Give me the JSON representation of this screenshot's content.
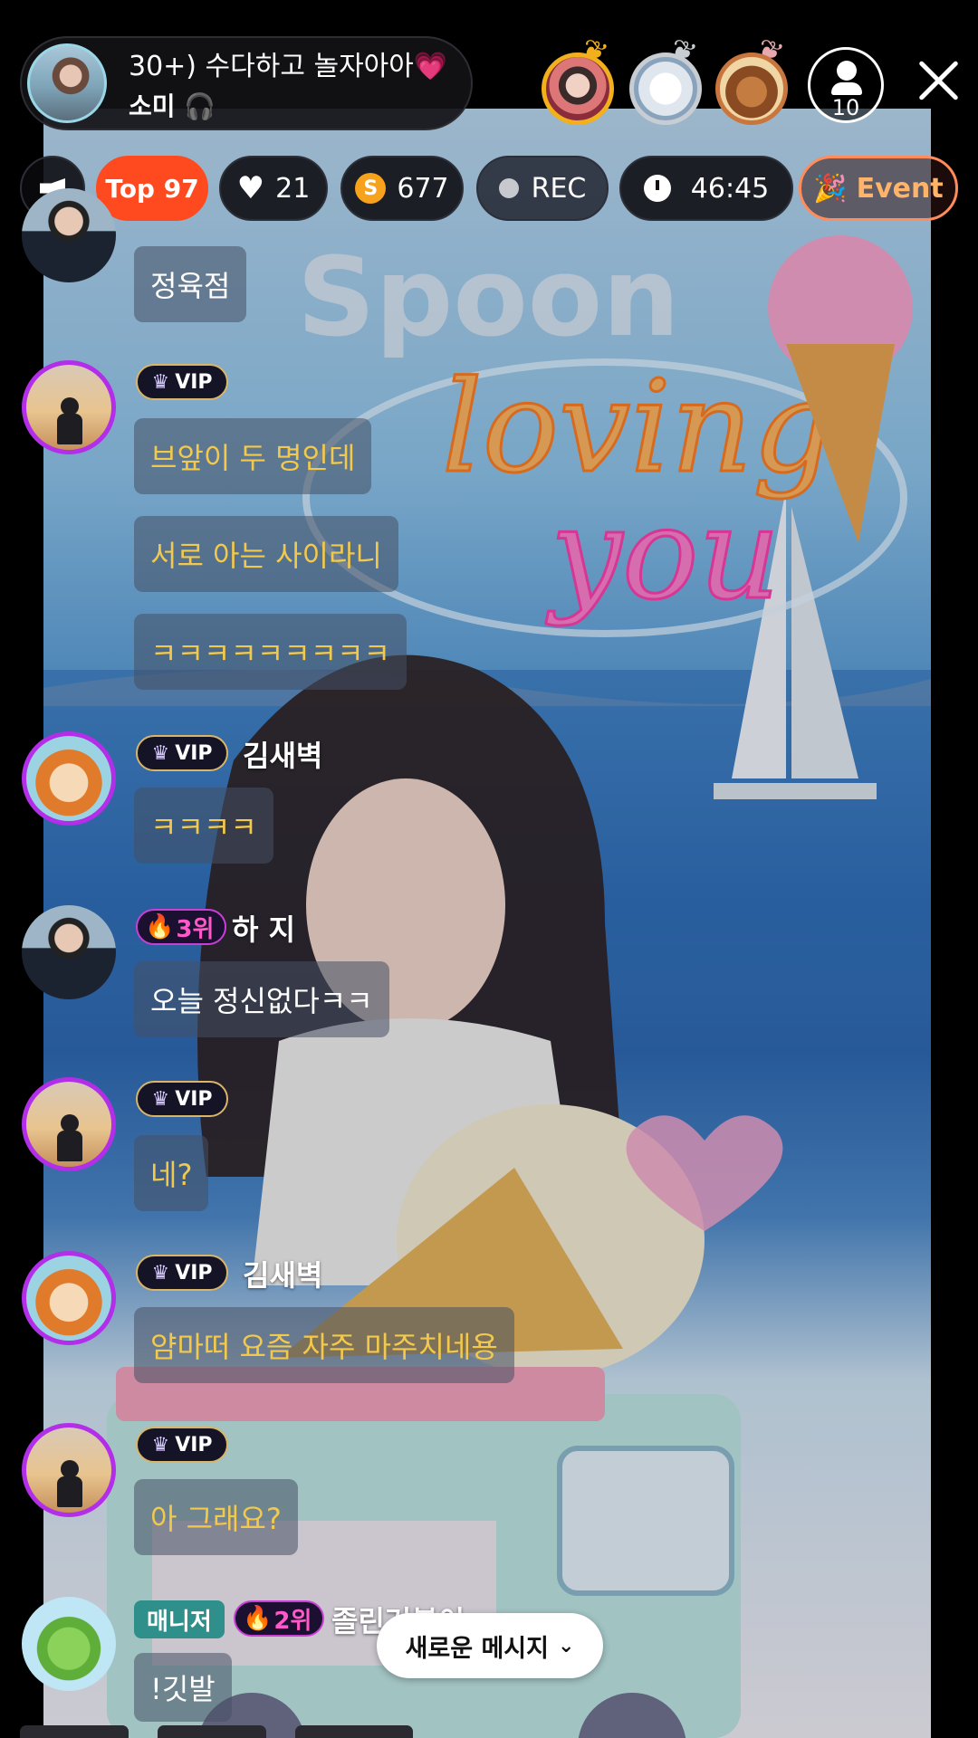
{
  "header": {
    "title": "30+) 수다하고 놀자아아",
    "title_emoji": "💗",
    "host_name": "소미",
    "host_icon": "🎧",
    "listener_count": "10"
  },
  "stats": {
    "top_label": "Top 97",
    "likes": "21",
    "spoons": "677",
    "coin_letter": "S",
    "rec_label": "REC",
    "timer": "46:45",
    "event_label": "Event"
  },
  "chat": {
    "vip_label": "VIP",
    "manager_label": "매니저",
    "messages": [
      {
        "text": "정육점"
      },
      {
        "text": "브앞이 두 명인데"
      },
      {
        "text": "서로 아는 사이라니"
      },
      {
        "text": "ㅋㅋㅋㅋㅋㅋㅋㅋㅋ"
      },
      {
        "nick": "김새벽",
        "text": "ㅋㅋㅋㅋ"
      },
      {
        "nick": "하 지",
        "rank": "3위",
        "text": "오늘 정신없다ㅋㅋ"
      },
      {
        "text": "네?"
      },
      {
        "nick": "김새벽",
        "text": "얌마떠 요즘 자주 마주치네용"
      },
      {
        "text": "아 그래요?"
      },
      {
        "nick": "졸린거북이",
        "rank": "2위",
        "text": "!깃발"
      }
    ]
  },
  "new_message_button": "새로운 메시지",
  "colors": {
    "top_chip": "#ff4a1f",
    "vip_border": "#d8b56a",
    "avatar_ring": "#b22ee8",
    "gold_text": "#f2c94c",
    "rank_text": "#ff58c8",
    "manager_bg": "#2f8f8a"
  }
}
